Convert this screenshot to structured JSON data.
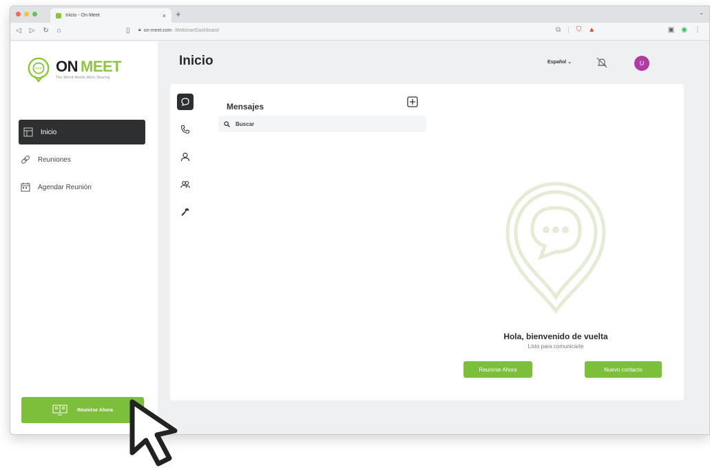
{
  "browser": {
    "tab_title": "Inicio - On-Meet",
    "tab_close": "×",
    "new_tab": "+",
    "tab_menu": "⌄",
    "url_host": "on-meet.com",
    "url_path": "/Webinar/Dashboard"
  },
  "sidebar": {
    "logo_on": "ON",
    "logo_meet": "MEET",
    "logo_tagline": "The World Needs More Sharing",
    "items": [
      {
        "label": "Inicio",
        "icon": "home-icon",
        "active": true
      },
      {
        "label": "Reuniones",
        "icon": "link-icon",
        "active": false
      },
      {
        "label": "Agendar Reunión",
        "icon": "calendar-icon",
        "active": false
      }
    ],
    "meet_now_label": "Reunirse Ahora"
  },
  "header": {
    "title": "Inicio",
    "language": "Español ⌄",
    "avatar_initial": "U"
  },
  "messages": {
    "title": "Mensajes",
    "search_placeholder": "Buscar",
    "rail_icons": [
      "chat-icon",
      "phone-icon",
      "user-icon",
      "users-icon",
      "wrench-icon"
    ]
  },
  "empty_state": {
    "title": "Hola, bienvenido de vuelta",
    "subtitle": "Listo para comunicarte",
    "meet_now_label": "Reunirse Ahora",
    "new_contact_label": "Nuevo contacto"
  },
  "colors": {
    "accent": "#7cbf3a",
    "dark": "#2e2f31",
    "avatar": "#b03ba3",
    "illustration": "#e6edd8"
  }
}
